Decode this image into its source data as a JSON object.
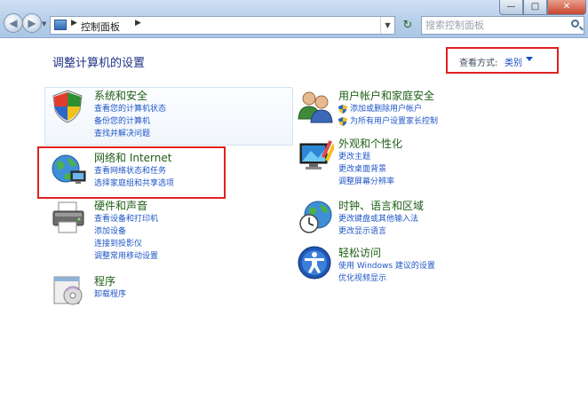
{
  "address_bar": {
    "breadcrumb": "控制面板"
  },
  "search": {
    "placeholder": "搜索控制面板"
  },
  "page_title": "调整计算机的设置",
  "view_by": {
    "label": "查看方式:",
    "value": "类别"
  },
  "categories_left": [
    {
      "title": "系统和安全",
      "icon": "shield-icon",
      "links": [
        "查看您的计算机状态",
        "备份您的计算机",
        "查找并解决问题"
      ]
    },
    {
      "title": "网络和 Internet",
      "icon": "network-globe-icon",
      "links": [
        "查看网络状态和任务",
        "选择家庭组和共享选项"
      ]
    },
    {
      "title": "硬件和声音",
      "icon": "printer-icon",
      "links": [
        "查看设备和打印机",
        "添加设备",
        "连接到投影仪",
        "调整常用移动设置"
      ]
    },
    {
      "title": "程序",
      "icon": "programs-icon",
      "links": [
        "卸载程序"
      ]
    }
  ],
  "categories_right": [
    {
      "title": "用户帐户和家庭安全",
      "icon": "users-icon",
      "links": [
        "添加或删除用户帐户",
        "为所有用户设置家长控制"
      ]
    },
    {
      "title": "外观和个性化",
      "icon": "display-icon",
      "links": [
        "更改主题",
        "更改桌面背景",
        "调整屏幕分辨率"
      ]
    },
    {
      "title": "时钟、语言和区域",
      "icon": "clock-globe-icon",
      "links": [
        "更改键盘或其他输入法",
        "更改显示语言"
      ]
    },
    {
      "title": "轻松访问",
      "icon": "accessibility-icon",
      "links": [
        "使用 Windows 建议的设置",
        "优化视频显示"
      ]
    }
  ],
  "colors": {
    "heading": "#1e3287",
    "category_title": "#1f5e16",
    "link": "#1f56c6",
    "highlight_box": "#e0211f"
  }
}
